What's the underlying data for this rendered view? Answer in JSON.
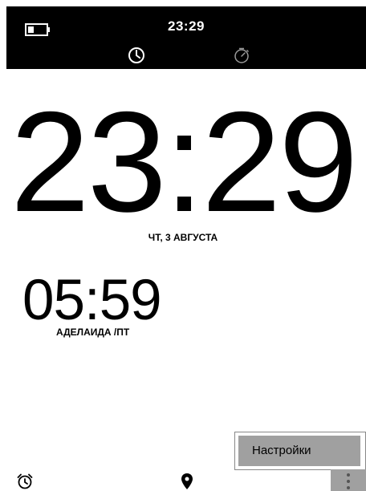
{
  "status_bar": {
    "time": "23:29",
    "battery_icon": "battery-low-icon"
  },
  "tabs": [
    {
      "icon": "clock-icon",
      "selected": true
    },
    {
      "icon": "stopwatch-icon",
      "selected": false
    }
  ],
  "clock": {
    "time": "23:29",
    "date": "ЧТ, 3 АВГУСТА"
  },
  "world_clock": {
    "time": "05:59",
    "city": "АДЕЛАИДА /ПТ"
  },
  "menu": {
    "items": [
      "Настройки"
    ]
  },
  "bottom_bar": {
    "icons": [
      "alarm-icon",
      "location-icon",
      "overflow-menu-icon"
    ]
  },
  "colors": {
    "header_background": "#000000",
    "highlight": "#a0a0a0"
  }
}
